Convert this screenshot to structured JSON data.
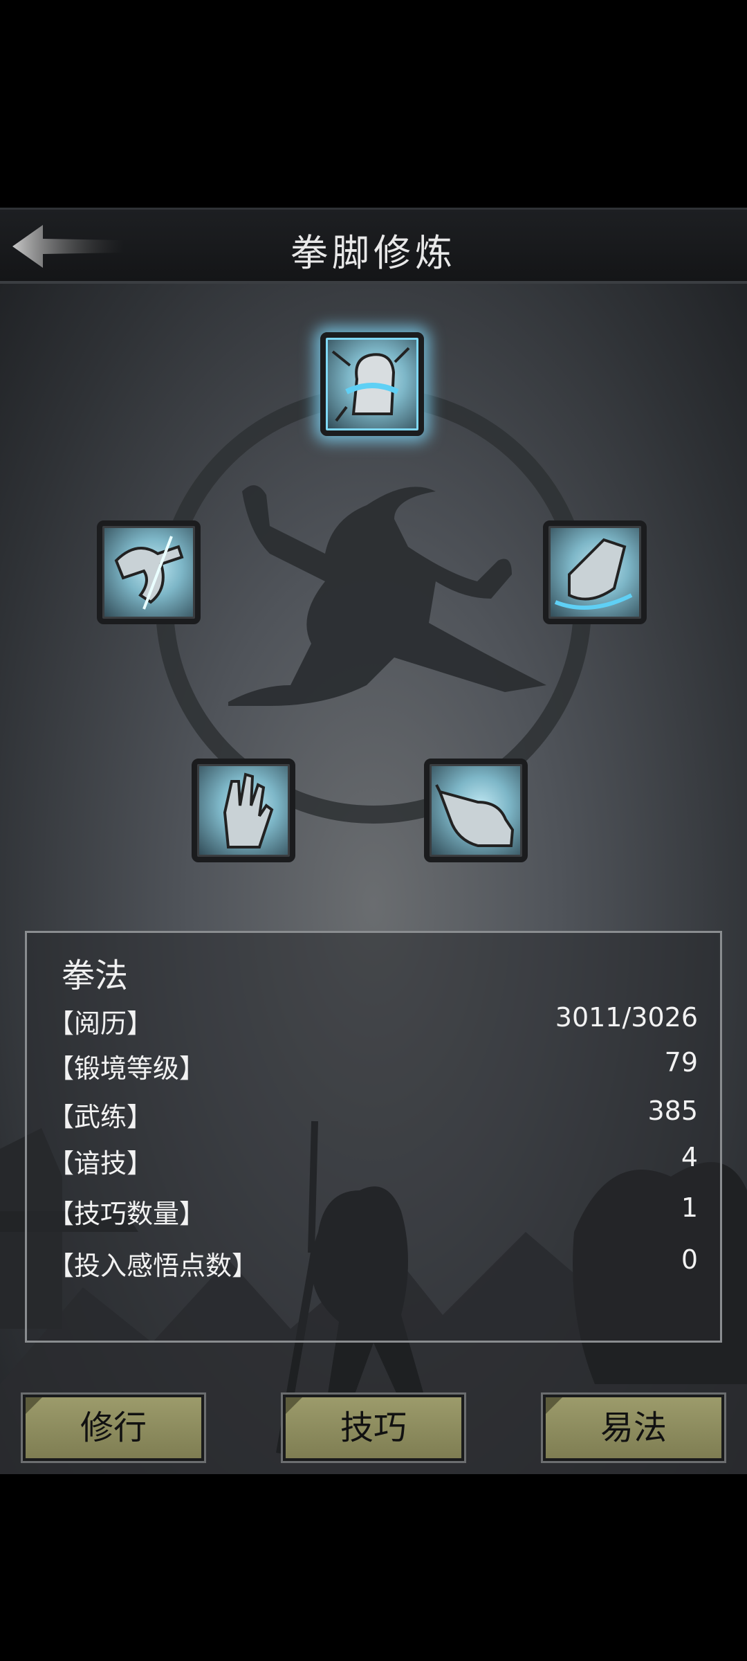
{
  "header": {
    "title": "拳脚修炼",
    "back_icon": "back-arrow-icon"
  },
  "skills": [
    {
      "name": "fist",
      "icon": "fist-icon",
      "active": true
    },
    {
      "name": "claw",
      "icon": "claw-icon",
      "active": false
    },
    {
      "name": "kick",
      "icon": "kick-icon",
      "active": false
    },
    {
      "name": "palm",
      "icon": "palm-icon",
      "active": false
    },
    {
      "name": "finger",
      "icon": "finger-icon",
      "active": false
    }
  ],
  "panel": {
    "title": "拳法",
    "rows": [
      {
        "label": "【阅历】",
        "value": "3011/3026"
      },
      {
        "label": "【锻境等级】",
        "value": "79"
      },
      {
        "label": "【武练】",
        "value": "385"
      },
      {
        "label": "【谙技】",
        "value": "4"
      },
      {
        "label": "【技巧数量】",
        "value": "1"
      },
      {
        "label": "【投入感悟点数】",
        "value": "0"
      }
    ]
  },
  "buttons": {
    "train": "修行",
    "skill": "技巧",
    "switch": "易法"
  },
  "colors": {
    "accent_glow": "#82dcff",
    "button_bg": "#9c9b6b"
  }
}
